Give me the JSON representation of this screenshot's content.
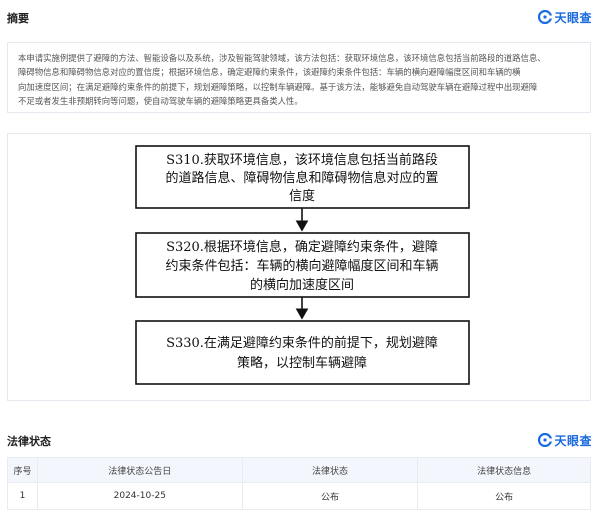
{
  "brand": {
    "name": "天眼查",
    "color": "#1a6ae0"
  },
  "abstract": {
    "title": "摘要",
    "lines": [
      "本申请实施例提供了避障的方法、智能设备以及系统，涉及智能驾驶领域，该方法包括：获取环境信息，该环境信息包括当前路段的道路信息、",
      "障碍物信息和障碍物信息对应的置信度；根据环境信息，确定避障约束条件，该避障约束条件包括：车辆的横向避障幅度区间和车辆的横",
      "向加速度区间；在满足避障约束条件的前提下，规划避障策略，以控制车辆避障。基于该方法，能够避免自动驾驶车辆在避障过程中出现避障",
      "不足或者发生非预期转向等问题，使自动驾驶车辆的避障策略更具备类人性。"
    ]
  },
  "flowchart": {
    "steps": [
      {
        "id": "S310",
        "lines": [
          "S310.获取环境信息，该环境信息包括当前路段",
          "的道路信息、障碍物信息和障碍物信息对应的置",
          "信度"
        ]
      },
      {
        "id": "S320",
        "lines": [
          "S320.根据环境信息，确定避障约束条件，避障",
          "约束条件包括：车辆的横向避障幅度区间和车辆",
          "的横向加速度区间"
        ]
      },
      {
        "id": "S330",
        "lines": [
          "S330.在满足避障约束条件的前提下，规划避障",
          "策略，以控制车辆避障"
        ]
      }
    ]
  },
  "legal": {
    "title": "法律状态",
    "columns": [
      "序号",
      "法律状态公告日",
      "法律状态",
      "法律状态信息"
    ],
    "rows": [
      [
        "1",
        "2024-10-25",
        "公布",
        "公布"
      ]
    ]
  }
}
